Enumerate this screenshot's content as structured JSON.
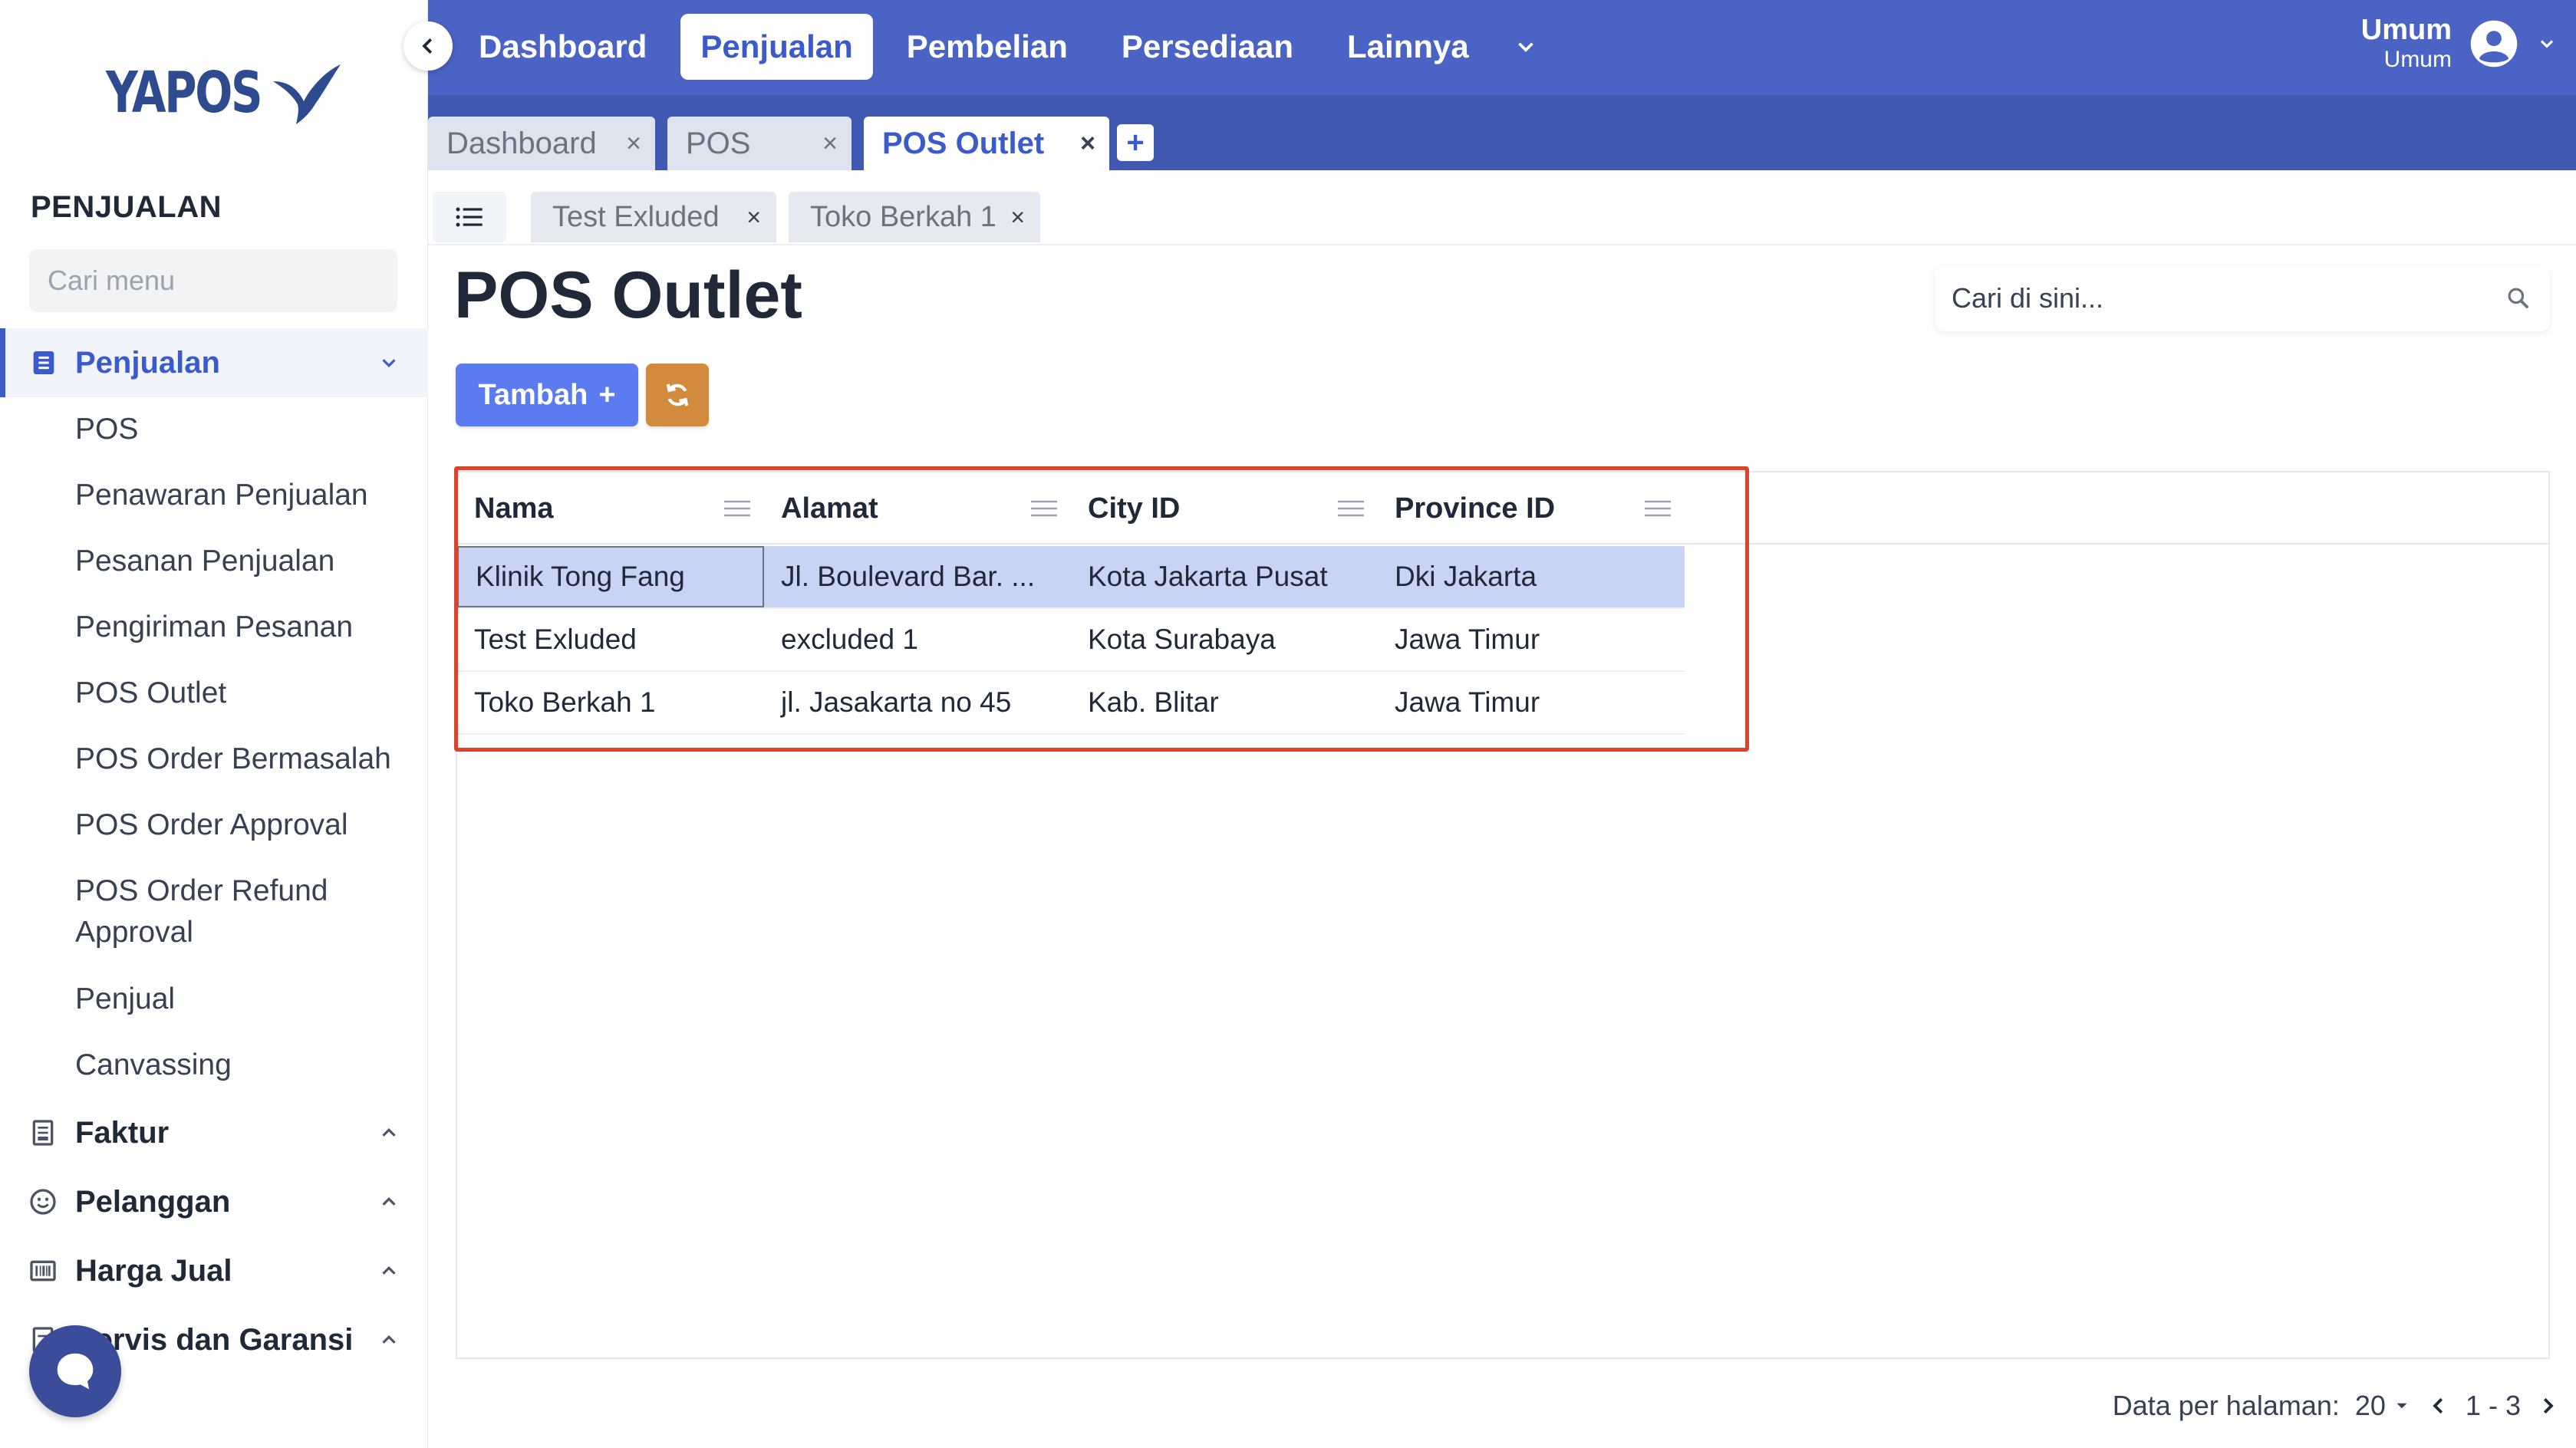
{
  "app": {
    "logo_text": "YAPOS"
  },
  "sidebar": {
    "section_title": "PENJUALAN",
    "search_placeholder": "Cari menu",
    "groups": [
      {
        "label": "Penjualan",
        "icon": "document-list-icon",
        "expanded": true
      },
      {
        "label": "Faktur",
        "icon": "receipt-icon"
      },
      {
        "label": "Pelanggan",
        "icon": "smiley-icon"
      },
      {
        "label": "Harga Jual",
        "icon": "barcode-icon"
      },
      {
        "label": "Servis dan Garansi",
        "icon": "document-icon"
      }
    ],
    "sub_items": [
      "POS",
      "Penawaran Penjualan",
      "Pesanan Penjualan",
      "Pengiriman Pesanan",
      "POS Outlet",
      "POS Order Bermasalah",
      "POS Order Approval",
      "POS Order Refund Approval",
      "Penjual",
      "Canvassing"
    ]
  },
  "topnav": {
    "items": [
      "Dashboard",
      "Penjualan",
      "Pembelian",
      "Persediaan",
      "Lainnya"
    ],
    "active": "Penjualan"
  },
  "user": {
    "name": "Umum",
    "role": "Umum"
  },
  "window_tabs": [
    {
      "label": "Dashboard",
      "active": false
    },
    {
      "label": "POS",
      "active": false
    },
    {
      "label": "POS Outlet",
      "active": true
    }
  ],
  "add_tab_label": "+",
  "sub_tabs": [
    "Test Exluded",
    "Toko Berkah 1"
  ],
  "page": {
    "title": "POS Outlet",
    "search_placeholder": "Cari di sini...",
    "add_button": "Tambah",
    "add_button_icon": "+"
  },
  "table": {
    "columns": [
      "Nama",
      "Alamat",
      "City ID",
      "Province ID"
    ],
    "rows": [
      [
        "Klinik Tong Fang",
        "Jl. Boulevard Bar. ...",
        "Kota Jakarta Pusat",
        "Dki Jakarta"
      ],
      [
        "Test Exluded",
        "excluded 1",
        "Kota Surabaya",
        "Jawa Timur"
      ],
      [
        "Toko Berkah 1",
        "jl. Jasakarta no 45",
        "Kab. Blitar",
        "Jawa Timur"
      ]
    ],
    "selected_row": 0
  },
  "pagination": {
    "label": "Data per halaman:",
    "per_page": "20",
    "range": "1 - 3"
  },
  "colors": {
    "primary": "#4b63c4",
    "accent": "#3b5bcc",
    "add_button": "#5b7cf0",
    "refresh_button": "#d28a3c",
    "highlight": "#e0412b",
    "selected_row": "#c9d3f3"
  }
}
